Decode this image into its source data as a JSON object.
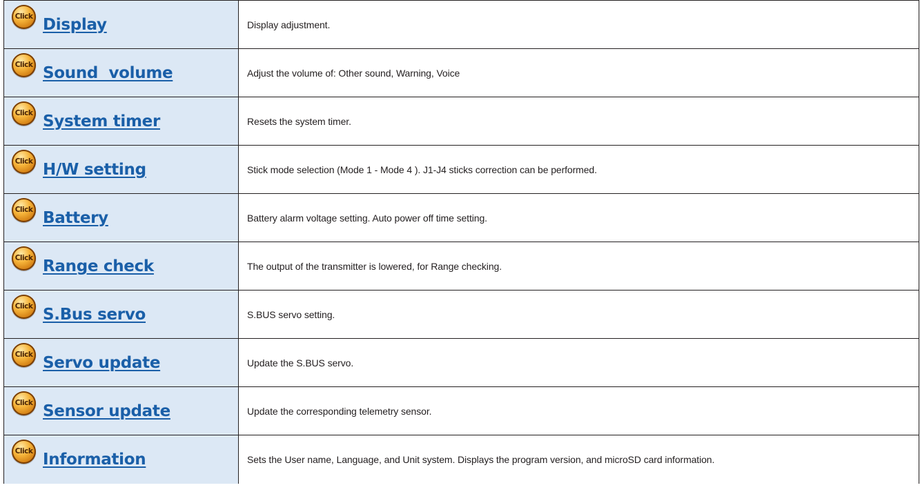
{
  "badge_label": "Click",
  "colors": {
    "name_cell_bg": "#dce8f5",
    "link": "#1a5fa8",
    "border": "#231f20",
    "badge": "#e8992a"
  },
  "icons": {
    "badge": "click-badge-icon"
  },
  "menu": {
    "items": [
      {
        "label": "Display",
        "description": "Display adjustment."
      },
      {
        "label": "Sound  volume",
        "description": "Adjust the volume of: Other sound, Warning, Voice"
      },
      {
        "label": "System timer",
        "description": "Resets the system timer."
      },
      {
        "label": "H/W setting",
        "description": "Stick mode selection (Mode 1 - Mode 4 ). J1-J4 sticks correction can be performed."
      },
      {
        "label": "Battery",
        "description": "Battery alarm voltage setting. Auto power off time setting."
      },
      {
        "label": "Range check",
        "description": "The output of the transmitter is lowered, for Range checking."
      },
      {
        "label": "S.Bus servo",
        "description": "S.BUS servo setting."
      },
      {
        "label": "Servo update",
        "description": "Update the S.BUS servo."
      },
      {
        "label": "Sensor update",
        "description": "Update the corresponding telemetry sensor."
      },
      {
        "label": "Information",
        "description": "Sets the User name, Language, and Unit system. Displays the program version, and microSD card information."
      }
    ]
  }
}
